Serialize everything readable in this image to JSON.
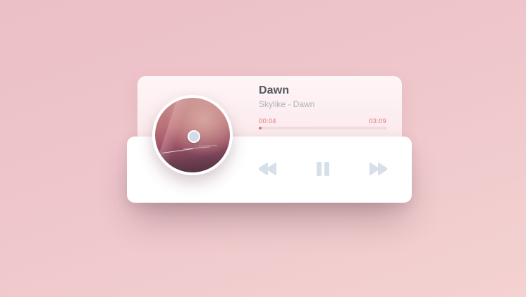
{
  "track": {
    "title": "Dawn",
    "subtitle": "Skylike - Dawn"
  },
  "progress": {
    "current_time": "00:04",
    "total_time": "03:09",
    "fraction": 0.021
  },
  "controls": {
    "rewind_icon": "rewind-icon",
    "pause_icon": "pause-icon",
    "forward_icon": "fast-forward-icon"
  },
  "colors": {
    "accent": "#e3727d",
    "control_icon": "#d7e0ea",
    "title_text": "#54565f",
    "subtitle_text": "#aeb2bb"
  }
}
